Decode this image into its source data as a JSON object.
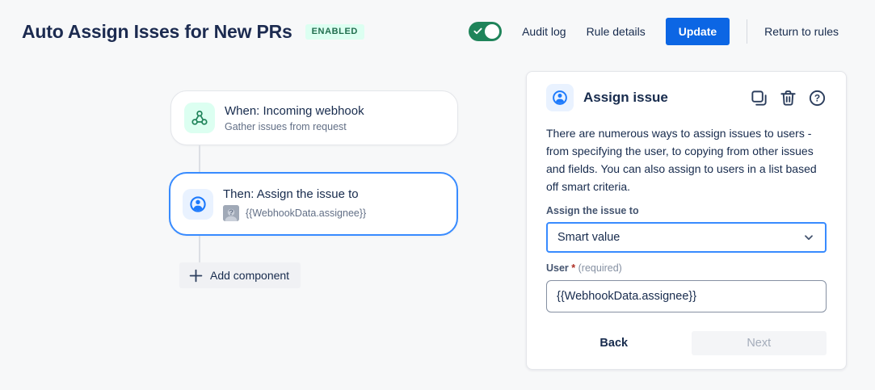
{
  "header": {
    "title": "Auto Assign Isses for New PRs",
    "status_badge": "ENABLED",
    "toggle_state": "on",
    "audit_log_label": "Audit log",
    "rule_details_label": "Rule details",
    "update_label": "Update",
    "return_label": "Return to rules"
  },
  "flow": {
    "trigger": {
      "title": "When: Incoming webhook",
      "subtitle": "Gather issues from request"
    },
    "action": {
      "title": "Then: Assign the issue to",
      "value": "{{WebhookData.assignee}}"
    },
    "add_component_label": "Add component"
  },
  "panel": {
    "title": "Assign issue",
    "description": "There are numerous ways to assign issues to users - from specifying the user, to copying from other issues and fields. You can also assign to users in a list based off smart criteria.",
    "assign_field": {
      "label": "Assign the issue to",
      "selected_value": "Smart value"
    },
    "user_field": {
      "label": "User",
      "required_star": "*",
      "required_hint": "(required)",
      "value": "{{WebhookData.assignee}}"
    },
    "back_label": "Back",
    "next_label": "Next"
  },
  "icons": {
    "toggle_check": "check-icon",
    "trigger": "webhook-icon",
    "action": "assignee-person-icon",
    "unknown_user": "unknown-user-avatar (person silhouette with ?)",
    "add": "plus-icon",
    "duplicate": "duplicate-icon",
    "delete": "trash-icon",
    "help": "question-circle-icon",
    "select_caret": "chevron-down-icon"
  },
  "colors": {
    "page_bg": "#F7F8F9",
    "accent_blue": "#0C66E4",
    "selected_border_blue": "#388BFF",
    "toggle_green": "#1F845A",
    "badge_bg": "#DCFFF1",
    "badge_text": "#216E4E",
    "icon_green_bg": "#DCFFF1",
    "icon_blue_bg": "#E9F2FF",
    "text_primary": "#172B4D",
    "text_secondary": "#626F86",
    "required_red": "#AE2E24"
  }
}
